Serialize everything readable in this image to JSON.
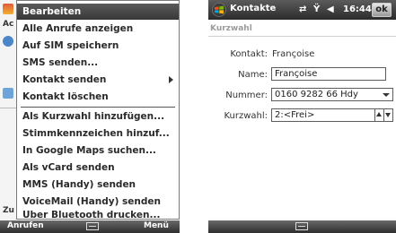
{
  "left_screen": {
    "background_fragments": [
      "Ac",
      "Zu"
    ],
    "menu_items": [
      "Bearbeiten",
      "Alle Anrufe anzeigen",
      "Auf SIM speichern",
      "SMS senden...",
      "Kontakt senden",
      "Kontakt löschen",
      "Als Kurzwahl hinzufügen...",
      "Stimmkennzeichen hinzuf...",
      "In Google Maps suchen...",
      "Als vCard senden",
      "MMS (Handy) senden",
      "VoiceMail (Handy) senden",
      "Über Bluetooth drucken..."
    ],
    "selected_index": 0,
    "softkeys": {
      "left": "Anrufen",
      "right": "Menü"
    }
  },
  "right_screen": {
    "title": "Kontakte",
    "time": "16:44",
    "ok_label": "ok",
    "section_title": "Kurzwahl",
    "kontakt_label": "Kontakt:",
    "kontakt_value": "Françoise",
    "name_label": "Name:",
    "name_value": "Françoise",
    "nummer_label": "Nummer:",
    "nummer_value": "0160 9282 66 Hdy",
    "kurzwahl_label": "Kurzwahl:",
    "kurzwahl_value": "2:<Frei>"
  },
  "colors": {
    "selected_item_bg": "#444444",
    "titlebar_bg": "#3a3a3a",
    "section_title": "#9b9b9b"
  },
  "icons": [
    "windows-start-icon",
    "sync-icon",
    "signal-icon",
    "volume-icon",
    "keyboard-icon",
    "submenu-arrow-icon",
    "dropdown-arrow-icon",
    "spin-up-icon",
    "spin-down-icon"
  ]
}
